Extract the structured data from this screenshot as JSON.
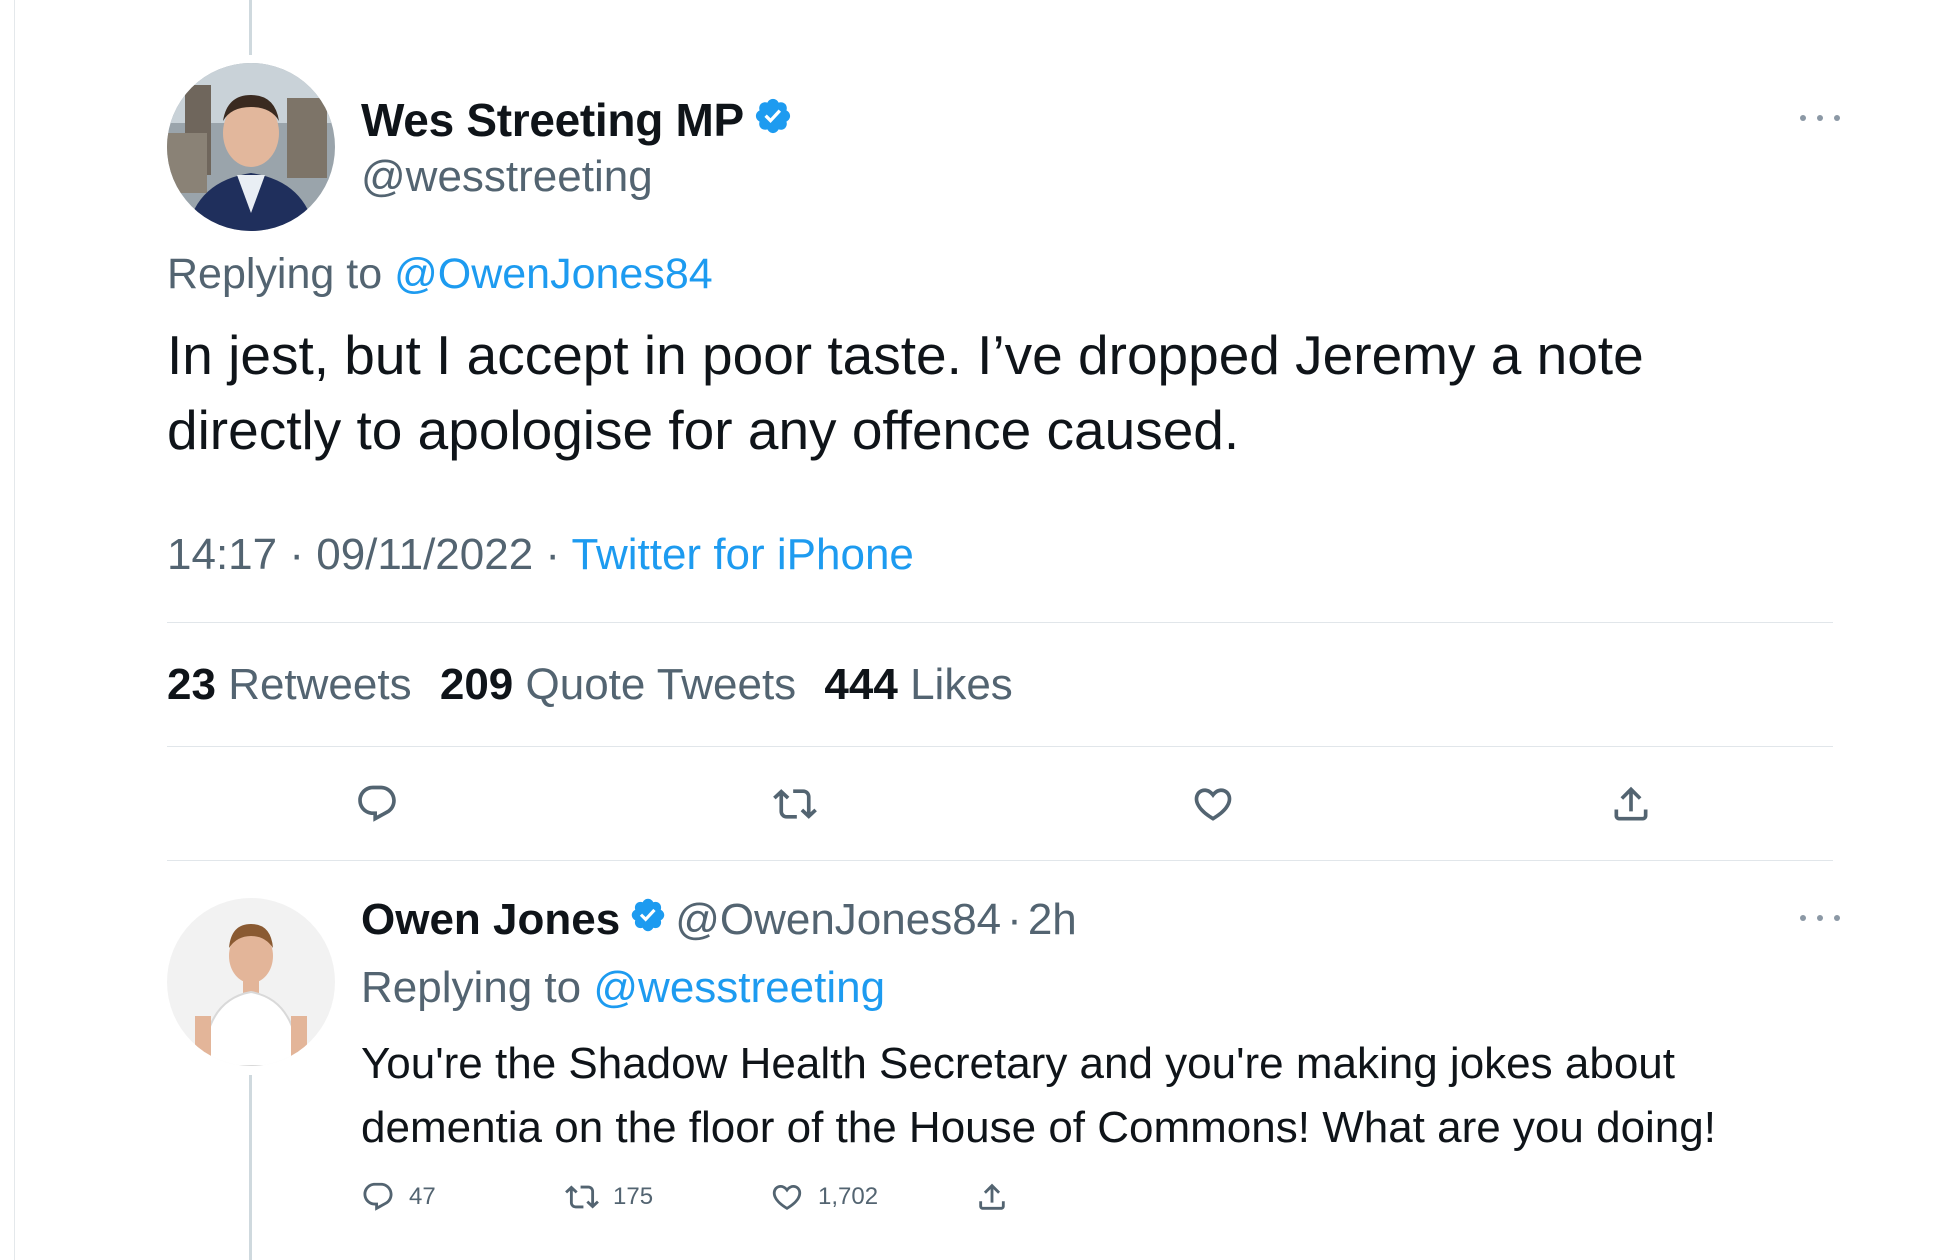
{
  "tweet": {
    "author_name": "Wes Streeting MP",
    "author_handle": "@wesstreeting",
    "replying_prefix": "Replying to",
    "replying_to": "@OwenJones84",
    "text": "In jest, but I accept in poor taste. I’ve dropped Jeremy a note directly to apologise for any offence caused.",
    "time": "14:17",
    "date": "09/11/2022",
    "source": "Twitter for iPhone",
    "separator": "·",
    "stats": {
      "retweets_count": "23",
      "retweets_label": "Retweets",
      "quotes_count": "209",
      "quotes_label": "Quote Tweets",
      "likes_count": "444",
      "likes_label": "Likes"
    }
  },
  "reply": {
    "author_name": "Owen Jones",
    "author_handle": "@OwenJones84",
    "separator": "·",
    "time": "2h",
    "replying_prefix": "Replying to",
    "replying_to": "@wesstreeting",
    "text": "You're the Shadow Health Secretary and you're making jokes about dementia on the floor of the House of Commons! What are you doing!",
    "reply_count": "47",
    "retweet_count": "175",
    "like_count": "1,702"
  },
  "icons": {
    "verified": "verified-badge-icon",
    "reply": "reply-icon",
    "retweet": "retweet-icon",
    "like": "heart-icon",
    "share": "share-icon",
    "more": "more-icon"
  },
  "colors": {
    "link": "#1d9bf0",
    "text": "#0f1419",
    "secondary": "#536471",
    "divider": "#e1e6ea"
  }
}
